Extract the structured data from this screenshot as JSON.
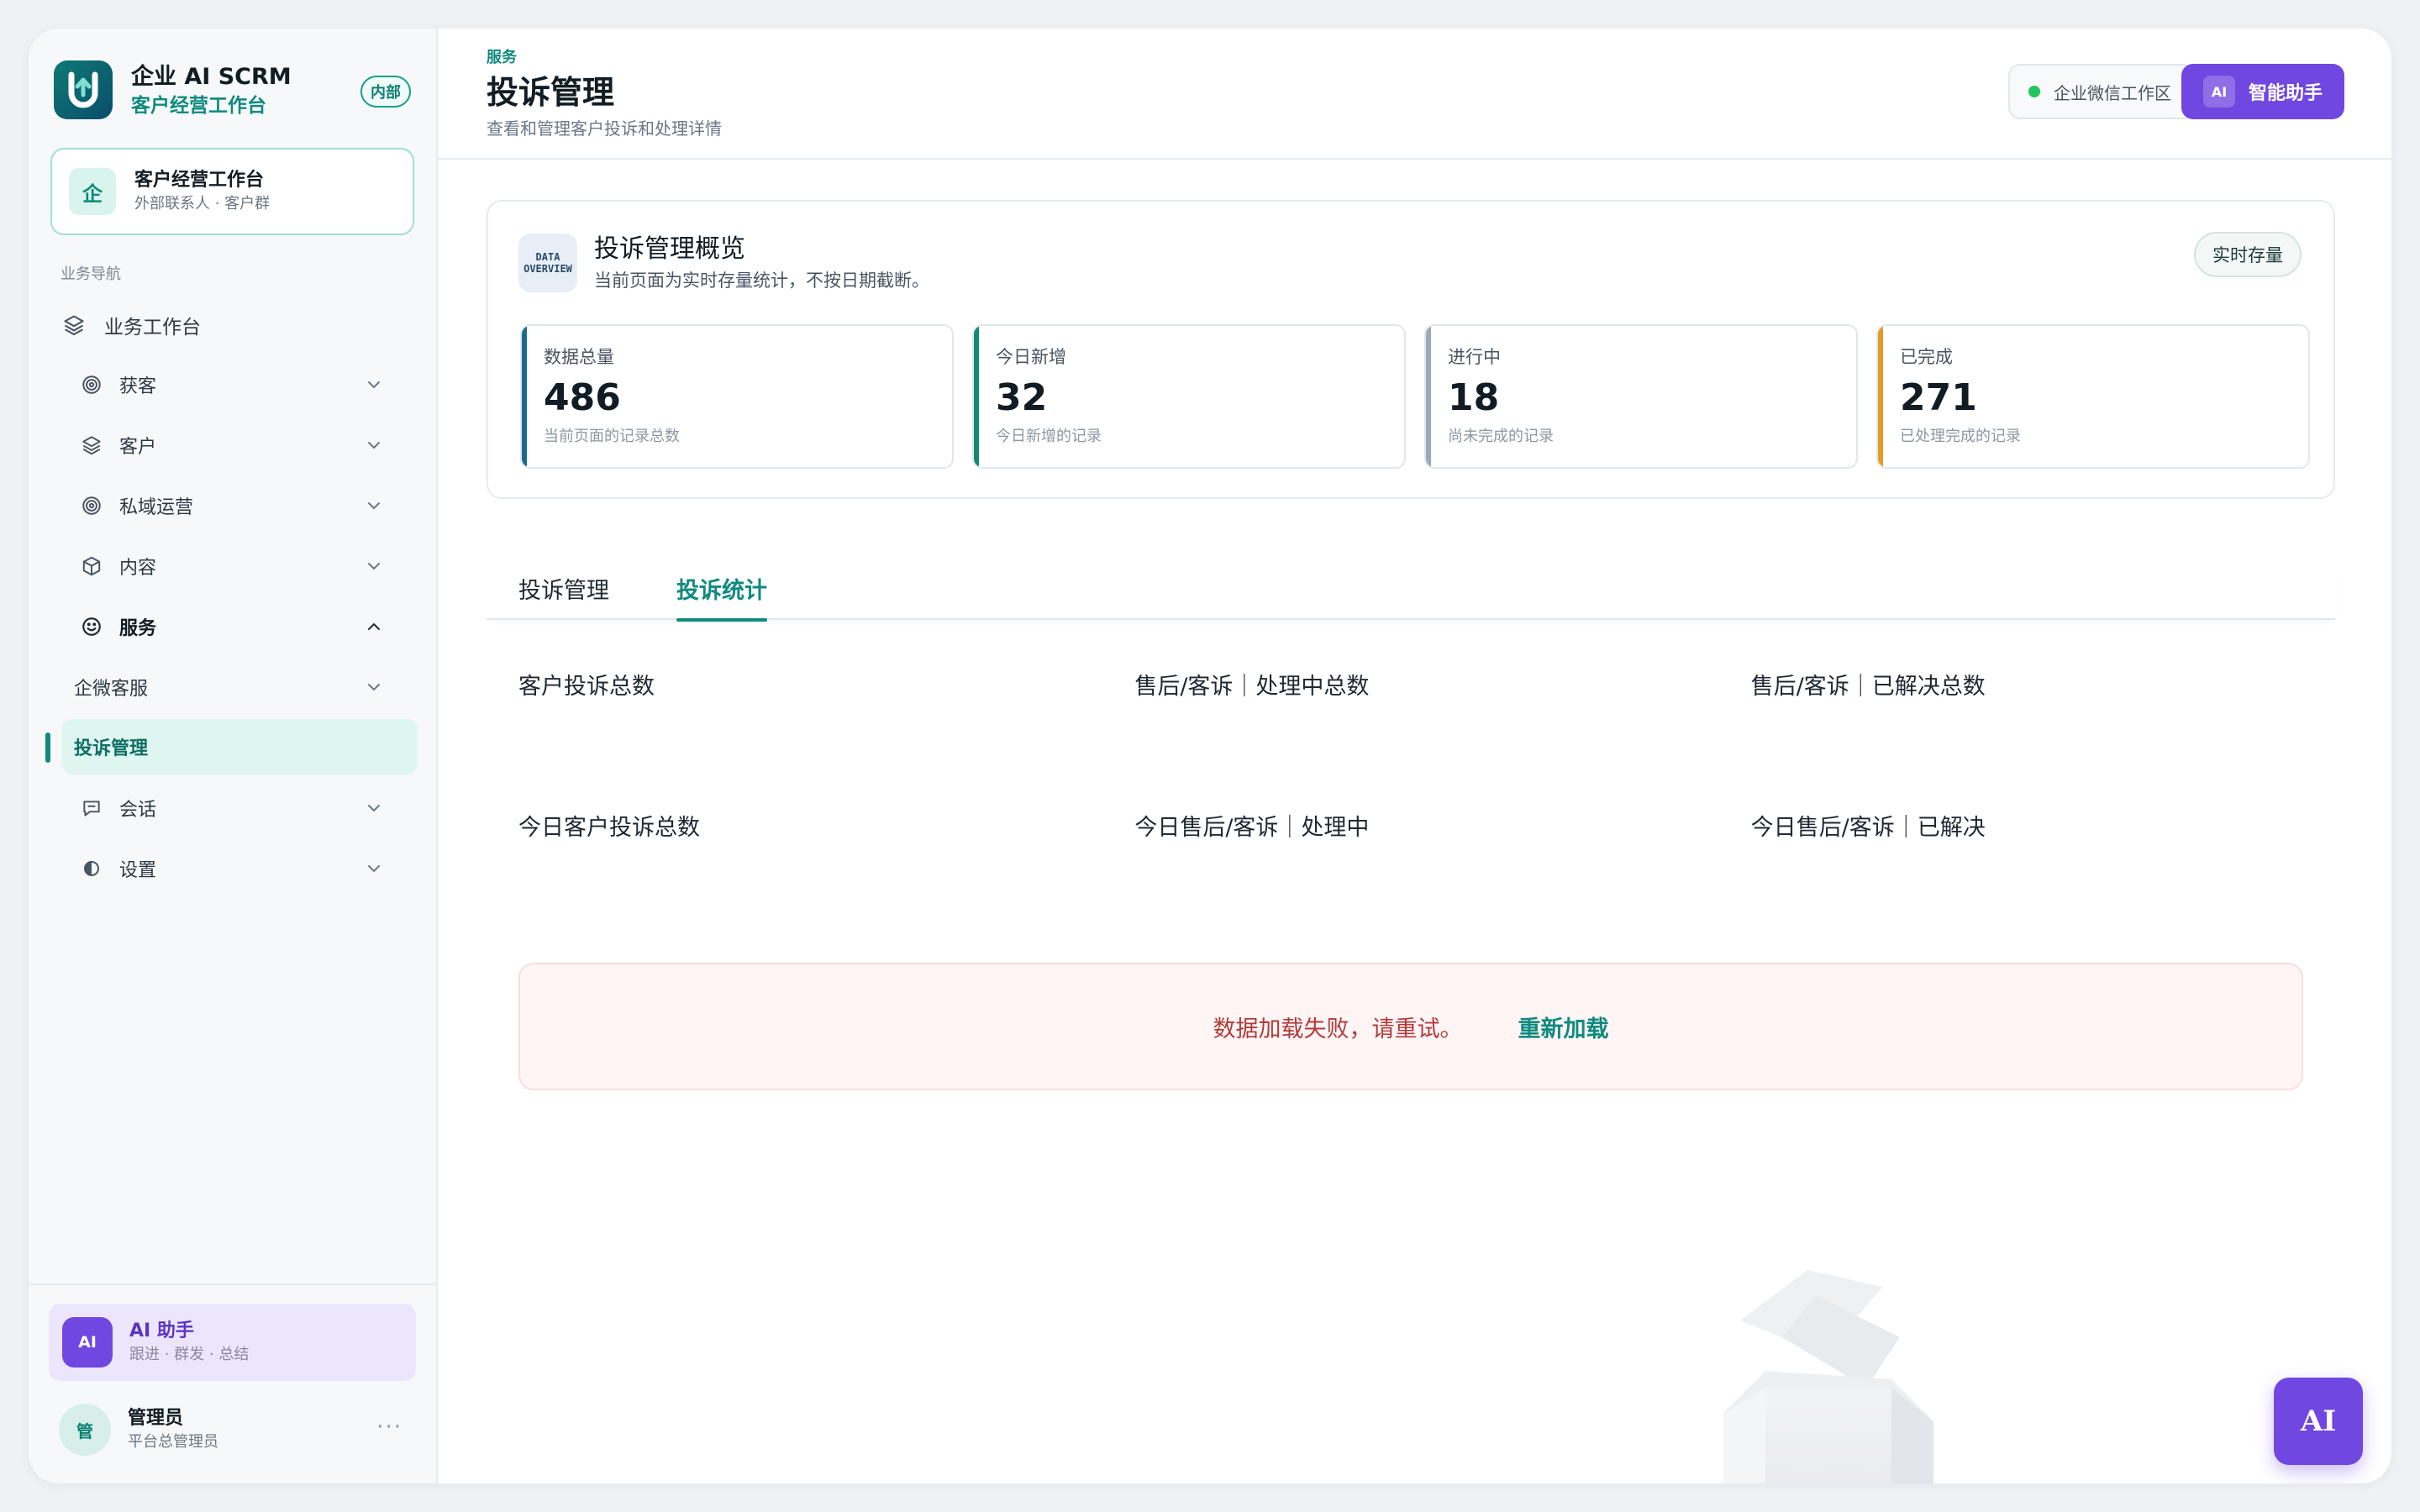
{
  "brand": {
    "title": "企业 AI SCRM",
    "subtitle": "客户经营工作台",
    "badge": "内部"
  },
  "workspace": {
    "icon_char": "企",
    "title": "客户经营工作台",
    "subtitle": "外部联系人 · 客户群"
  },
  "nav": {
    "caption": "业务导航",
    "home": "业务工作台",
    "items": [
      {
        "label": "获客",
        "icon": "target-icon"
      },
      {
        "label": "客户",
        "icon": "layers-icon"
      },
      {
        "label": "私域运营",
        "icon": "target-icon"
      },
      {
        "label": "内容",
        "icon": "box-icon"
      },
      {
        "label": "服务",
        "icon": "smile-icon"
      }
    ],
    "service_sub": "企微客服",
    "active": "投诉管理",
    "after": [
      {
        "label": "会话",
        "icon": "chat-icon"
      },
      {
        "label": "设置",
        "icon": "settings-icon"
      }
    ]
  },
  "ai_card": {
    "badge": "AI",
    "title": "AI 助手",
    "subtitle": "跟进 · 群发 · 总结"
  },
  "user": {
    "avatar_char": "管",
    "name": "管理员",
    "role": "平台总管理员",
    "more": "···"
  },
  "header": {
    "crumb": "服务",
    "title": "投诉管理",
    "desc": "查看和管理客户投诉和处理详情",
    "env": "企业微信工作区",
    "assistant_badge": "AI",
    "assistant": "智能助手"
  },
  "overview": {
    "icon_line1": "DATA",
    "icon_line2": "OVERVIEW",
    "title": "投诉管理概览",
    "subtitle": "当前页面为实时存量统计，不按日期截断。",
    "pill": "实时存量",
    "stats": [
      {
        "label": "数据总量",
        "value": "486",
        "note": "当前页面的记录总数"
      },
      {
        "label": "今日新增",
        "value": "32",
        "note": "今日新增的记录"
      },
      {
        "label": "进行中",
        "value": "18",
        "note": "尚未完成的记录"
      },
      {
        "label": "已完成",
        "value": "271",
        "note": "已处理完成的记录"
      }
    ]
  },
  "tabs": [
    {
      "label": "投诉管理"
    },
    {
      "label": "投诉统计"
    }
  ],
  "metrics": [
    [
      "客户投诉总数",
      "售后/客诉｜处理中总数",
      "售后/客诉｜已解决总数"
    ],
    [
      "今日客户投诉总数",
      "今日售后/客诉｜处理中",
      "今日售后/客诉｜已解决"
    ]
  ],
  "error": {
    "message": "数据加载失败，请重试。",
    "retry": "重新加载"
  },
  "fab": "AI",
  "colors": {
    "brand": "#0f8a7e",
    "purple": "#7047e0",
    "error": "#b33a3a"
  }
}
